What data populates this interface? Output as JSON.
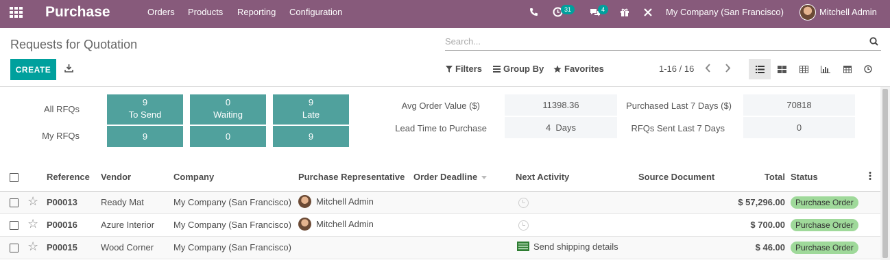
{
  "topbar": {
    "app_name": "Purchase",
    "menu": [
      "Orders",
      "Products",
      "Reporting",
      "Configuration"
    ],
    "activity_count": "31",
    "message_count": "4",
    "company": "My Company (San Francisco)",
    "user": "Mitchell Admin"
  },
  "control_panel": {
    "breadcrumb": "Requests for Quotation",
    "search_placeholder": "Search...",
    "create_label": "CREATE",
    "filters_label": "Filters",
    "group_by_label": "Group By",
    "favorites_label": "Favorites",
    "pager": "1-16 / 16"
  },
  "dashboard": {
    "all_rfqs_label": "All RFQs",
    "my_rfqs_label": "My RFQs",
    "tiles": [
      {
        "count": "9",
        "label": "To Send",
        "my": "9"
      },
      {
        "count": "0",
        "label": "Waiting",
        "my": "0"
      },
      {
        "count": "9",
        "label": "Late",
        "my": "9"
      }
    ],
    "stats": [
      {
        "label": "Avg Order Value ($)",
        "value": "11398.36"
      },
      {
        "label": "Lead Time to Purchase",
        "value": "4  Days"
      },
      {
        "label": "Purchased Last 7 Days ($)",
        "value": "70818"
      },
      {
        "label": "RFQs Sent Last 7 Days",
        "value": "0"
      }
    ]
  },
  "table": {
    "headers": [
      "Reference",
      "Vendor",
      "Company",
      "Purchase Representative",
      "Order Deadline",
      "Next Activity",
      "Source Document",
      "Total",
      "Status"
    ],
    "rows": [
      {
        "reference": "P00013",
        "vendor": "Ready Mat",
        "company": "My Company (San Francisco)",
        "rep": "Mitchell Admin",
        "activity": "",
        "total": "$ 57,296.00",
        "status": "Purchase Order"
      },
      {
        "reference": "P00016",
        "vendor": "Azure Interior",
        "company": "My Company (San Francisco)",
        "rep": "Mitchell Admin",
        "activity": "",
        "total": "$ 700.00",
        "status": "Purchase Order"
      },
      {
        "reference": "P00015",
        "vendor": "Wood Corner",
        "company": "My Company (San Francisco)",
        "rep": "",
        "activity": "Send shipping details",
        "total": "$ 46.00",
        "status": "Purchase Order"
      }
    ]
  },
  "colors": {
    "brand": "#875a7b",
    "primary": "#00a09d",
    "tile": "#50a19d",
    "status_badge": "#9fd99a"
  }
}
